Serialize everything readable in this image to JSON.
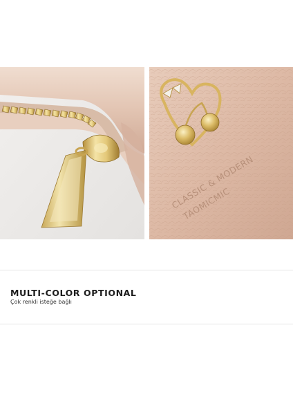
{
  "gallery": {
    "left_photo": {
      "subject": "zipper-pull-closeup"
    },
    "right_photo": {
      "subject": "embossed-logo-closeup",
      "embossed_line_1": "CLASSIC & MODERN",
      "embossed_line_2": "TAOMICMIC"
    }
  },
  "feature": {
    "title": "MULTI-COLOR OPTIONAL",
    "subtitle": "Çok renkli isteğe bağlı"
  },
  "colors": {
    "leather": "#dcb6a1",
    "leather_light": "#f3e2d6",
    "gold": "#d9b65e",
    "divider": "#e6e6e6",
    "title_text": "#1c1c1c"
  }
}
